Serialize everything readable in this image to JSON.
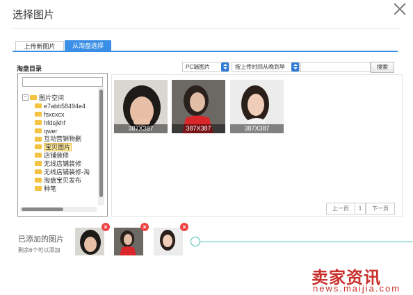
{
  "dialog": {
    "title": "选择图片"
  },
  "tabs": [
    {
      "label": "上传新图片"
    },
    {
      "label": "从淘盘选择"
    }
  ],
  "directory": {
    "label": "淘盘目录",
    "root": "图片空间",
    "items": [
      "e7abb58494e4",
      "fsxcxcx",
      "hfdsjkhf",
      "qwer",
      "互动营销物删",
      "宝贝图片",
      "店铺装修",
      "无线店铺装修",
      "无线店铺装修-淘",
      "淘盘宝贝发布",
      "种笔"
    ],
    "selected": "宝贝图片"
  },
  "filters": {
    "source_select": "PC端图片",
    "sort_select": "按上传时间从晚到早",
    "keyword": "",
    "search_button": "搜索"
  },
  "thumbnails": [
    {
      "size": "387X387"
    },
    {
      "size": "387X387"
    },
    {
      "size": "387X387"
    }
  ],
  "pagination": {
    "prev": "上一页",
    "current": "1",
    "next": "下一页"
  },
  "added": {
    "label": "已添加的图片",
    "remaining": "剩余6个可以添加",
    "count": 3
  },
  "watermark": {
    "brand": "卖家资讯",
    "url": "news.maijia.com"
  },
  "colors": {
    "accent": "#3a8ee6",
    "remove": "#e44444",
    "slider": "#3fbfae"
  }
}
